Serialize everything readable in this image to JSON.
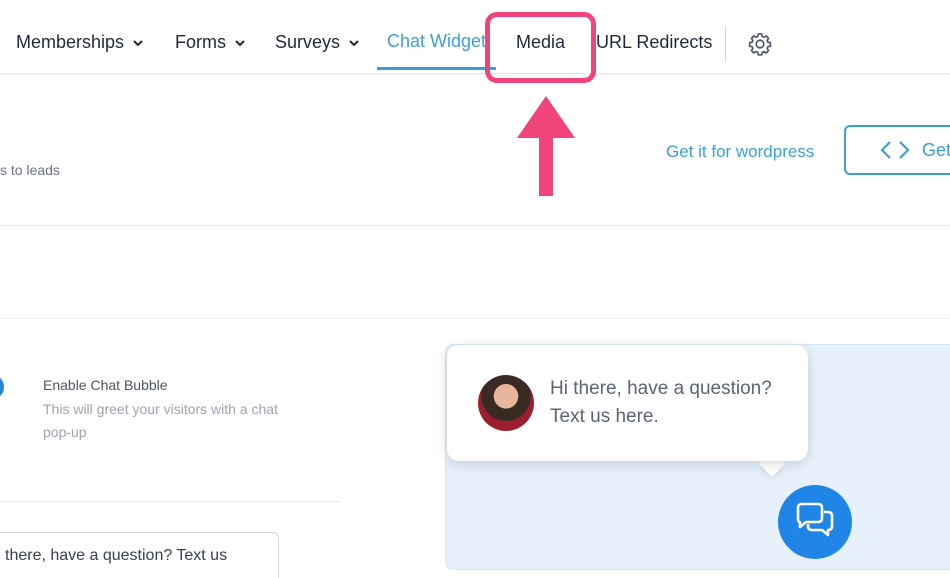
{
  "nav": {
    "items": [
      {
        "label": "Memberships",
        "has_dropdown": true
      },
      {
        "label": "Forms",
        "has_dropdown": true
      },
      {
        "label": "Surveys",
        "has_dropdown": true
      },
      {
        "label": "Chat Widget",
        "active": true
      },
      {
        "label": "Media",
        "highlighted": true
      },
      {
        "label": "URL Redirects"
      }
    ],
    "settings_icon": "gear-icon"
  },
  "annotation": {
    "highlight_color": "#f0447a"
  },
  "header": {
    "description_tail": "s to leads",
    "wordpress_link": "Get it for wordpress",
    "get_code_button": "Get"
  },
  "settings": {
    "chat_bubble": {
      "title": "Enable Chat Bubble",
      "description": "This will greet your visitors with a chat pop-up"
    },
    "message_value": " there, have a question? Text us"
  },
  "preview": {
    "message": "Hi there, have a question? Text us here."
  },
  "colors": {
    "accent": "#3b9fd8",
    "fab": "#1f86e8",
    "preview_bg": "#e6f1fc"
  }
}
